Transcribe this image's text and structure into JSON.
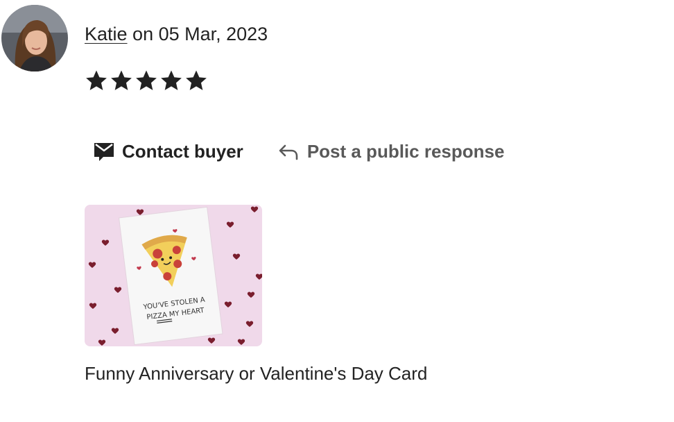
{
  "review": {
    "reviewer_name": "Katie",
    "date_text": " on 05 Mar, 2023",
    "rating": 5,
    "max_rating": 5
  },
  "actions": {
    "contact_label": "Contact buyer",
    "contact_icon": "envelope-icon",
    "respond_label": "Post a public response",
    "respond_icon": "reply-arrow-icon"
  },
  "product": {
    "title": "Funny Anniversary or Valentine's Day Card",
    "card_text_line1": "YOU'VE STOLEN A",
    "card_text_line2": "PIZZA MY HEART"
  },
  "colors": {
    "text": "#222222",
    "muted_text": "#595959",
    "thumb_background": "#f0d9ea",
    "heart": "#7a1e2e"
  }
}
